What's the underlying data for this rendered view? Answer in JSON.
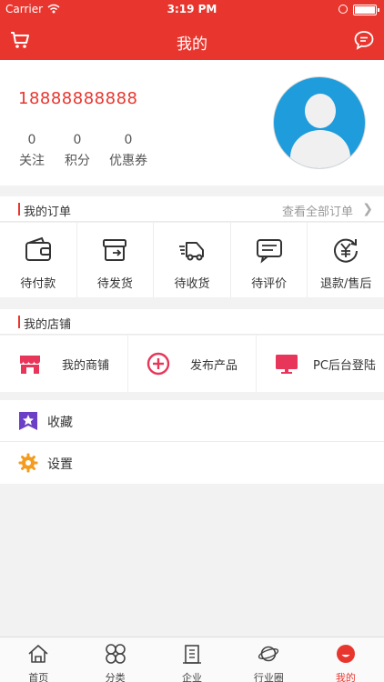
{
  "status": {
    "carrier": "Carrier",
    "time": "3:19 PM"
  },
  "nav": {
    "title": "我的"
  },
  "profile": {
    "phone": "18888888888",
    "stats": [
      {
        "value": "0",
        "label": "关注"
      },
      {
        "value": "0",
        "label": "积分"
      },
      {
        "value": "0",
        "label": "优惠券"
      }
    ]
  },
  "orders": {
    "title": "我的订单",
    "view_all": "查看全部订单",
    "items": [
      {
        "label": "待付款",
        "icon": "wallet-icon"
      },
      {
        "label": "待发货",
        "icon": "box-icon"
      },
      {
        "label": "待收货",
        "icon": "truck-icon"
      },
      {
        "label": "待评价",
        "icon": "comment-icon"
      },
      {
        "label": "退款/售后",
        "icon": "refund-icon"
      }
    ]
  },
  "shop": {
    "title": "我的店铺",
    "items": [
      {
        "label": "我的商铺",
        "icon": "store-icon"
      },
      {
        "label": "发布产品",
        "icon": "plus-circle-icon"
      },
      {
        "label": "PC后台登陆",
        "icon": "monitor-icon"
      }
    ]
  },
  "menu": [
    {
      "label": "收藏",
      "icon": "star-icon"
    },
    {
      "label": "设置",
      "icon": "gear-icon"
    }
  ],
  "tabs": [
    {
      "label": "首页",
      "icon": "home-icon"
    },
    {
      "label": "分类",
      "icon": "category-icon"
    },
    {
      "label": "企业",
      "icon": "building-icon"
    },
    {
      "label": "行业圈",
      "icon": "planet-icon"
    },
    {
      "label": "我的",
      "icon": "profile-icon"
    }
  ],
  "colors": {
    "accent": "#e8362f",
    "avatar_bg": "#1e9cdc",
    "star": "#6b3fc6",
    "gear": "#f39c1f"
  }
}
